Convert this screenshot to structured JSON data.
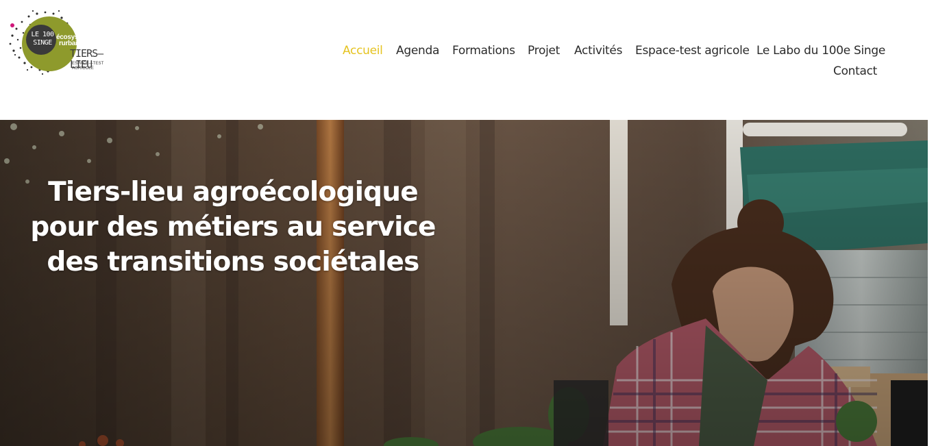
{
  "logo": {
    "line1": "LE 100",
    "line2": "SINGE",
    "eco_line1": "écosystème",
    "eco_line2": "rurbain",
    "tiers_lieu": "TIERS—LIEU",
    "subtitle": "ESPACE—TEST AGRICOLE"
  },
  "nav": {
    "items": [
      {
        "label": "Accueil",
        "active": true
      },
      {
        "label": "Agenda"
      },
      {
        "label": "Formations"
      },
      {
        "label": "Projet"
      },
      {
        "label": "Activités"
      },
      {
        "label": "Espace-test agricole"
      },
      {
        "label": "Le Labo du 100e Singe"
      },
      {
        "label": "Contact"
      }
    ]
  },
  "hero": {
    "title_line1": "Tiers-lieu agroécologique",
    "title_line2": "pour des métiers au service",
    "title_line3": "des transitions sociétales"
  },
  "colors": {
    "accent": "#e5c320",
    "logo_green": "#8e9a2c",
    "nav_text": "#2b2b2b"
  }
}
